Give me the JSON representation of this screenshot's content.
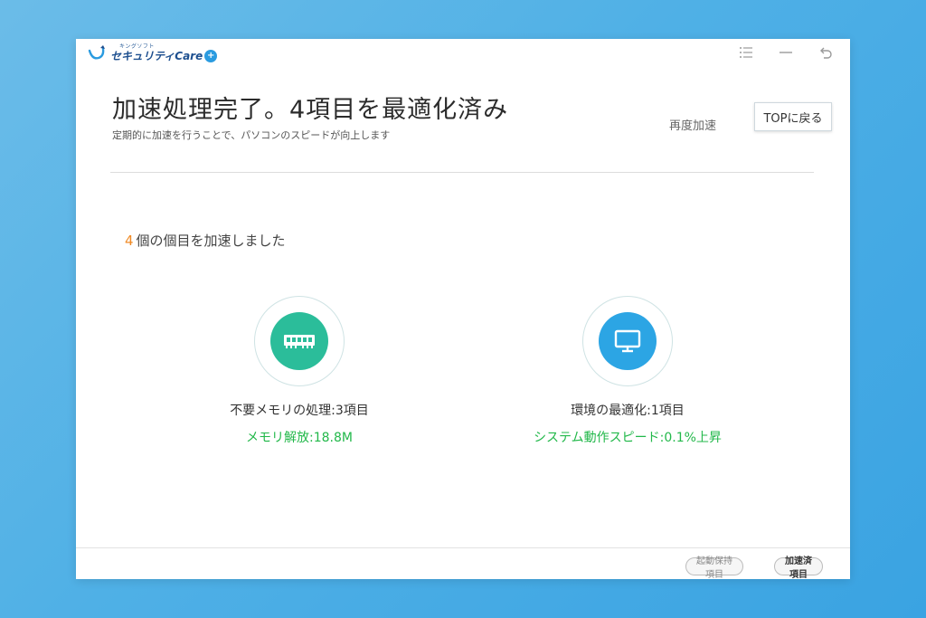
{
  "app": {
    "logo_sub": "キングソフト",
    "logo_main": "セキュリティCare",
    "logo_plus": "+"
  },
  "window_controls": {
    "menu_icon": "menu-icon",
    "minimize_icon": "minimize-icon",
    "back_icon": "undo-icon"
  },
  "header": {
    "title": "加速処理完了。4項目を最適化済み",
    "subtitle": "定期的に加速を行うことで、パソコンのスピードが向上します",
    "retry_label": "再度加速",
    "top_button_label": "TOPに戻る"
  },
  "summary": {
    "count": "4",
    "text": "個の個目を加速しました",
    "count_color": "#f08a24"
  },
  "results": [
    {
      "icon": "memory-icon",
      "label": "不要メモリの処理:3項目",
      "detail": "メモリ解放:18.8M",
      "color": "#2bbd9a"
    },
    {
      "icon": "monitor-icon",
      "label": "環境の最適化:1項目",
      "detail": "システム動作スピード:0.1%上昇",
      "color": "#2ca5e4"
    }
  ],
  "footer": {
    "startup_label": "起動保持項目",
    "accelerated_label": "加速済項目"
  },
  "colors": {
    "background": "#4fb0e6",
    "detail_text": "#22b84a"
  }
}
